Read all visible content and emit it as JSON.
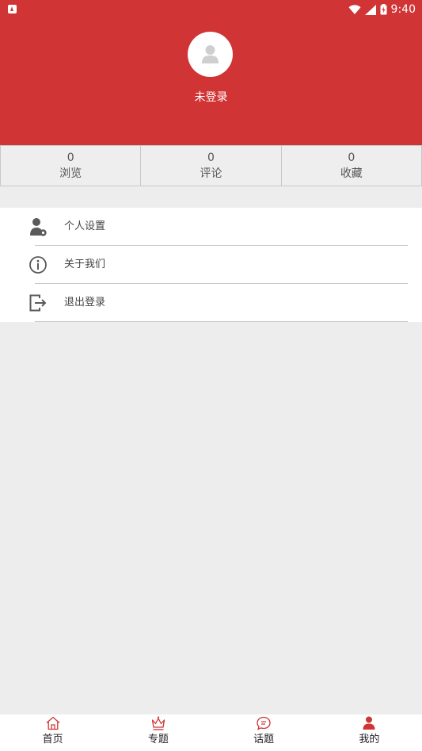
{
  "status_bar": {
    "time": "9:40",
    "icons": [
      "notification-app-icon",
      "wifi-icon",
      "signal-icon",
      "battery-icon"
    ]
  },
  "profile": {
    "avatar_icon": "user-avatar-icon",
    "login_text": "未登录"
  },
  "stats": [
    {
      "value": "0",
      "label": "浏览"
    },
    {
      "value": "0",
      "label": "评论"
    },
    {
      "value": "0",
      "label": "收藏"
    }
  ],
  "menu": [
    {
      "label": "个人设置",
      "icon": "user-settings-icon"
    },
    {
      "label": "关于我们",
      "icon": "info-icon"
    },
    {
      "label": "退出登录",
      "icon": "logout-icon"
    }
  ],
  "bottom_nav": [
    {
      "label": "首页",
      "icon": "home-icon"
    },
    {
      "label": "专题",
      "icon": "crown-icon"
    },
    {
      "label": "话题",
      "icon": "chat-bubble-icon"
    },
    {
      "label": "我的",
      "icon": "person-icon",
      "active": true
    }
  ],
  "colors": {
    "brand": "#d03434",
    "background": "#ededed",
    "text": "#444444"
  }
}
